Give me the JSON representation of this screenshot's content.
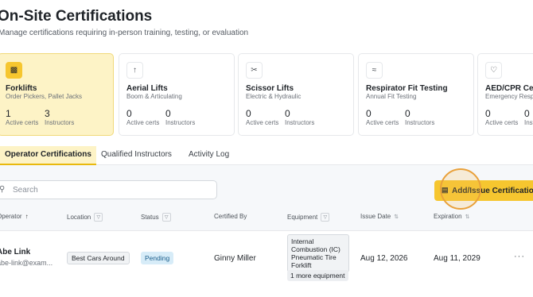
{
  "header": {
    "title": "On-Site Certifications",
    "subtitle": "Manage certifications requiring in-person training, testing, or evaluation"
  },
  "cards": [
    {
      "icon": "truck-icon",
      "title": "Forklifts",
      "subtitle": "Order Pickers, Pallet Jacks",
      "active_count": "1",
      "active_label": "Active certs",
      "instructors_count": "3",
      "instructors_label": "Instructors"
    },
    {
      "icon": "arrow-up-icon",
      "title": "Aerial Lifts",
      "subtitle": "Boom & Articulating",
      "active_count": "0",
      "active_label": "Active certs",
      "instructors_count": "0",
      "instructors_label": "Instructors"
    },
    {
      "icon": "scissors-icon",
      "title": "Scissor Lifts",
      "subtitle": "Electric & Hydraulic",
      "active_count": "0",
      "active_label": "Active certs",
      "instructors_count": "0",
      "instructors_label": "Instructors"
    },
    {
      "icon": "wind-icon",
      "title": "Respirator Fit Testing",
      "subtitle": "Annual Fit Testing",
      "active_count": "0",
      "active_label": "Active certs",
      "instructors_count": "0",
      "instructors_label": "Instructors"
    },
    {
      "icon": "heart-pulse-icon",
      "title": "AED/CPR Cert",
      "subtitle": "Emergency Resp",
      "active_count": "0",
      "active_label": "Active certs",
      "instructors_count": "0",
      "instructors_label": "Instru"
    }
  ],
  "tabs": [
    {
      "label": "Operator Certifications",
      "active": true
    },
    {
      "label": "Qualified Instructors",
      "active": false
    },
    {
      "label": "Activity Log",
      "active": false
    }
  ],
  "search": {
    "placeholder": "Search",
    "value": ""
  },
  "add_button": {
    "label": "Add/Issue Certification"
  },
  "table": {
    "columns": [
      {
        "label": "Operator",
        "sort": "asc"
      },
      {
        "label": "Location",
        "filter": true
      },
      {
        "label": "Status",
        "filter": true
      },
      {
        "label": "Certified By"
      },
      {
        "label": "Equipment",
        "filter": true
      },
      {
        "label": "Issue Date",
        "sortable": true
      },
      {
        "label": "Expiration",
        "sortable": true
      }
    ],
    "rows": [
      {
        "name": "Abe Link",
        "email": "abe-link@exam...",
        "location": "Best Cars Around",
        "status": "Pending",
        "certified_by": "Ginny Miller",
        "equipment": [
          "Internal Combustion (IC) Pneumatic Tire Forklift"
        ],
        "more_equipment": "1 more equipment",
        "issue_date": "Aug 12, 2026",
        "expiration": "Aug 11, 2029"
      }
    ]
  },
  "colors": {
    "accent": "#f6c62f",
    "active_card_bg": "#fdf3c6",
    "status_pending_bg": "#d7ecf8",
    "focus_ring": "#e9a13b"
  }
}
